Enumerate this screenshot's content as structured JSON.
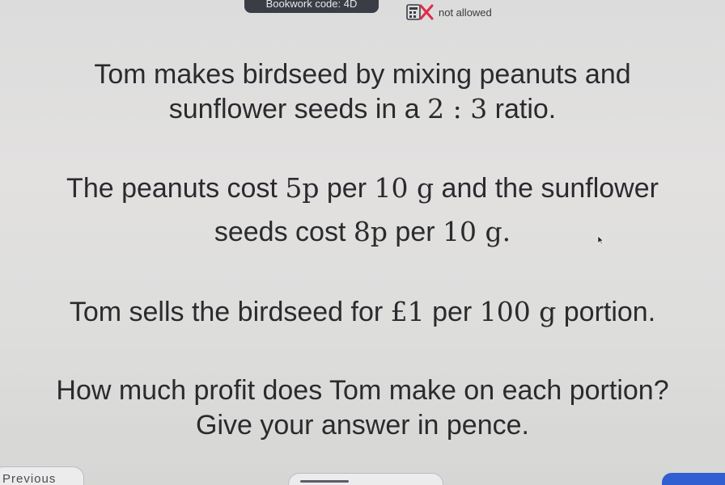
{
  "header": {
    "code_text": "Bookwork code: 4D",
    "calculator_status": "not allowed",
    "calculator_icon": "calculator-crossed-icon",
    "accent_color": "#e02a4a"
  },
  "question": {
    "line1": "Tom makes birdseed by mixing peanuts and",
    "line2_prefix": "sunflower seeds in a ",
    "line2_ratio": "2 : 3",
    "line2_suffix": " ratio.",
    "line3_prefix": "The peanuts cost ",
    "line3_cost": "5p",
    "line3_mid": " per ",
    "line3_weight": "10 g",
    "line3_suffix": " and the sunflower",
    "line4_prefix": "seeds cost ",
    "line4_cost": "8p",
    "line4_mid": " per ",
    "line4_weight": "10 g.",
    "line5_prefix": "Tom sells the birdseed for ",
    "line5_price": "£1",
    "line5_mid": " per ",
    "line5_weight": "100 g",
    "line5_suffix": " portion.",
    "line6": "How much profit does Tom make on each portion?",
    "line7": "Give your answer in pence."
  },
  "nav": {
    "previous_label": "Previous",
    "next_color": "#2f5fd0"
  }
}
